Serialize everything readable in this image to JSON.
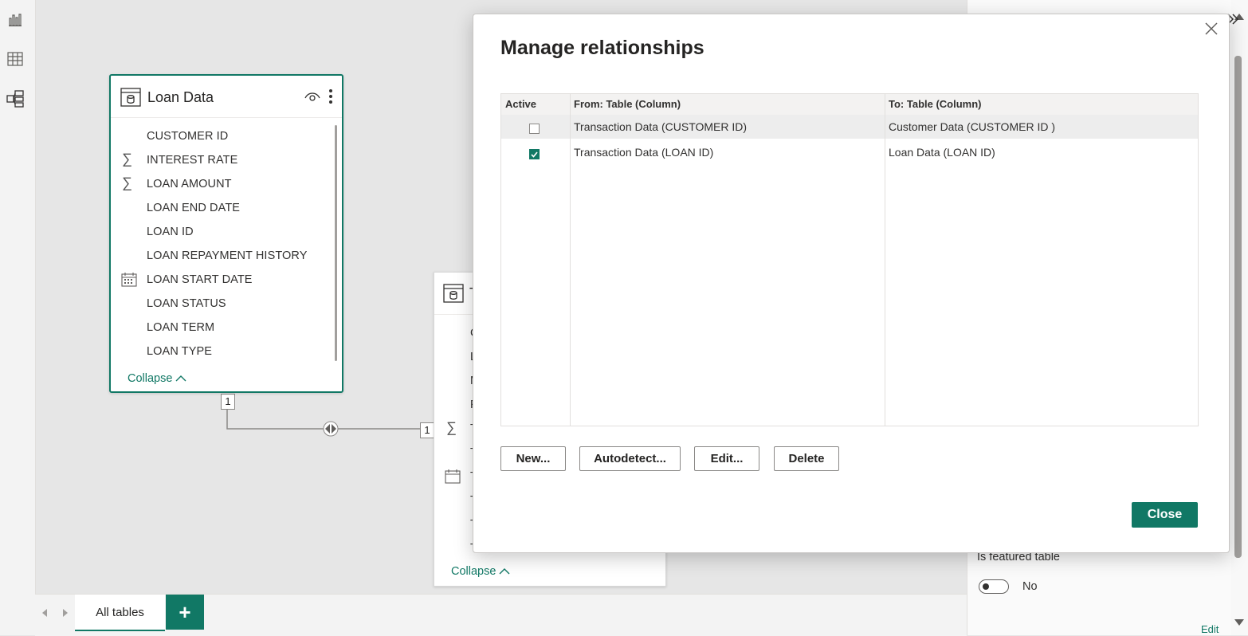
{
  "left_rail": {
    "icons": [
      "report-view-icon",
      "table-view-icon",
      "model-view-icon"
    ]
  },
  "loan_table": {
    "title": "Loan Data",
    "fields": [
      {
        "name": "CUSTOMER ID",
        "icon": ""
      },
      {
        "name": "INTEREST RATE",
        "icon": "sigma"
      },
      {
        "name": "LOAN AMOUNT",
        "icon": "sigma"
      },
      {
        "name": "LOAN END DATE",
        "icon": ""
      },
      {
        "name": "LOAN ID",
        "icon": ""
      },
      {
        "name": "LOAN REPAYMENT HISTORY",
        "icon": ""
      },
      {
        "name": "LOAN START DATE",
        "icon": "calendar"
      },
      {
        "name": "LOAN STATUS",
        "icon": ""
      },
      {
        "name": "LOAN TERM",
        "icon": ""
      },
      {
        "name": "LOAN TYPE",
        "icon": ""
      }
    ],
    "collapse_label": "Collapse"
  },
  "transaction_table": {
    "title_partial": "T",
    "field_initials": [
      "C",
      "L",
      "M",
      "P",
      "T",
      "T",
      "T",
      "T",
      "T",
      "T"
    ],
    "collapse_label": "Collapse"
  },
  "relationship_line": {
    "left_cardinality": "1",
    "right_cardinality": "1"
  },
  "right_panel": {
    "featured_label": "Is featured table",
    "featured_value": "No",
    "edit_label": "Edit"
  },
  "bottom_tabs": {
    "active_tab": "All tables",
    "add_symbol": "+"
  },
  "dialog": {
    "title": "Manage relationships",
    "columns": [
      "Active",
      "From: Table (Column)",
      "To: Table (Column)"
    ],
    "rows": [
      {
        "active": false,
        "from": "Transaction Data (CUSTOMER ID)",
        "to": "Customer Data (CUSTOMER ID )"
      },
      {
        "active": true,
        "from": "Transaction Data (LOAN ID)",
        "to": "Loan Data (LOAN ID)"
      }
    ],
    "buttons": {
      "new": "New...",
      "autodetect": "Autodetect...",
      "edit": "Edit...",
      "delete": "Delete",
      "close": "Close"
    }
  },
  "colors": {
    "accent": "#117865",
    "canvas": "#e6e6e6",
    "selected_row": "#ededed"
  }
}
